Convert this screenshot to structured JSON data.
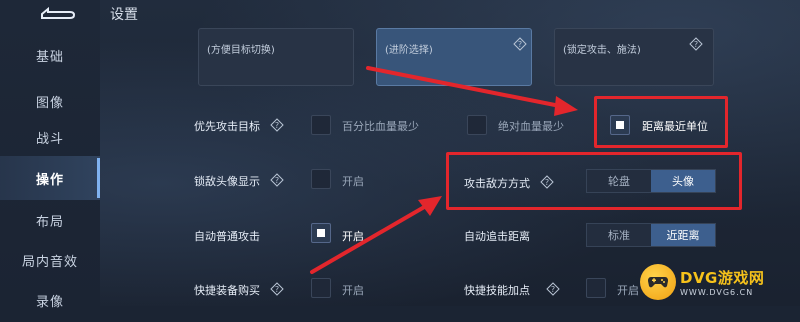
{
  "header": {
    "title": "设置"
  },
  "sidebar": {
    "items": [
      {
        "label": "基础"
      },
      {
        "label": "图像"
      },
      {
        "label": "战斗"
      },
      {
        "label": "操作"
      },
      {
        "label": "布局"
      },
      {
        "label": "局内音效"
      },
      {
        "label": "录像"
      }
    ],
    "active": "操作"
  },
  "cards": [
    {
      "sub": "(方便目标切换)"
    },
    {
      "sub": "(进阶选择)"
    },
    {
      "sub": "(锁定攻击、施法)"
    }
  ],
  "settings": {
    "priority_target": {
      "label": "优先攻击目标",
      "options": [
        "百分比血量最少",
        "绝对血量最少",
        "距离最近单位"
      ],
      "selected": "距离最近单位"
    },
    "lock_enemy_avatar": {
      "label": "锁敌头像显示",
      "option": "开启",
      "checked": false
    },
    "attack_enemy_mode": {
      "label": "攻击敌方方式",
      "options": [
        "轮盘",
        "头像"
      ],
      "selected": "头像"
    },
    "auto_attack": {
      "label": "自动普通攻击",
      "option": "开启",
      "checked": true
    },
    "auto_chase_distance": {
      "label": "自动追击距离",
      "options": [
        "标准",
        "近距离"
      ],
      "selected": "近距离"
    },
    "quick_buy_equipment": {
      "label": "快捷装备购买",
      "option": "开启",
      "checked": false
    },
    "quick_skill_points": {
      "label": "快捷技能加点",
      "option": "开启",
      "checked": false
    }
  },
  "watermark": {
    "name": "DVG游戏网",
    "url": "WWW.DVG6.CN"
  },
  "colors": {
    "highlight": "#e3262c",
    "accent": "#3d5f8e"
  },
  "icons": {
    "back": "back-arrow-icon",
    "help": "question-help-icon"
  }
}
